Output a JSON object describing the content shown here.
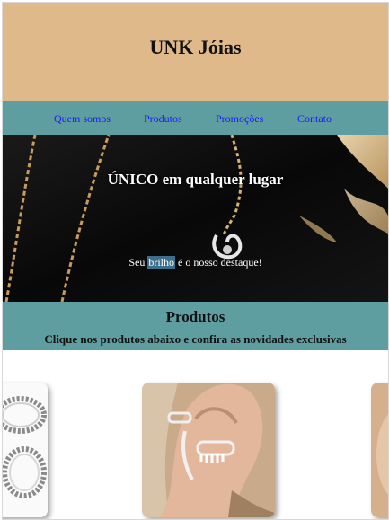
{
  "site": {
    "title": "UNK Jóias"
  },
  "nav": {
    "items": [
      {
        "label": "Quem somos"
      },
      {
        "label": "Produtos"
      },
      {
        "label": "Promoções"
      },
      {
        "label": "Contato"
      }
    ]
  },
  "banner": {
    "title": "ÚNICO em qualquer lugar",
    "subtitle_before": "Seu ",
    "subtitle_highlight": "brilho",
    "subtitle_after": " é o nosso destaque!"
  },
  "products_section": {
    "heading": "Produtos",
    "description": "Clique nos produtos abaixo e confira as novidades exclusivas"
  },
  "products": [
    {
      "image": "silver-rings-photo"
    },
    {
      "image": "ear-cuff-earring-photo"
    },
    {
      "image": "partial-product-photo"
    }
  ],
  "colors": {
    "header_bg": "#e0b98a",
    "nav_bg": "#5f9ea0",
    "link": "#1a1aff",
    "banner_bg": "#0c0c0c"
  }
}
